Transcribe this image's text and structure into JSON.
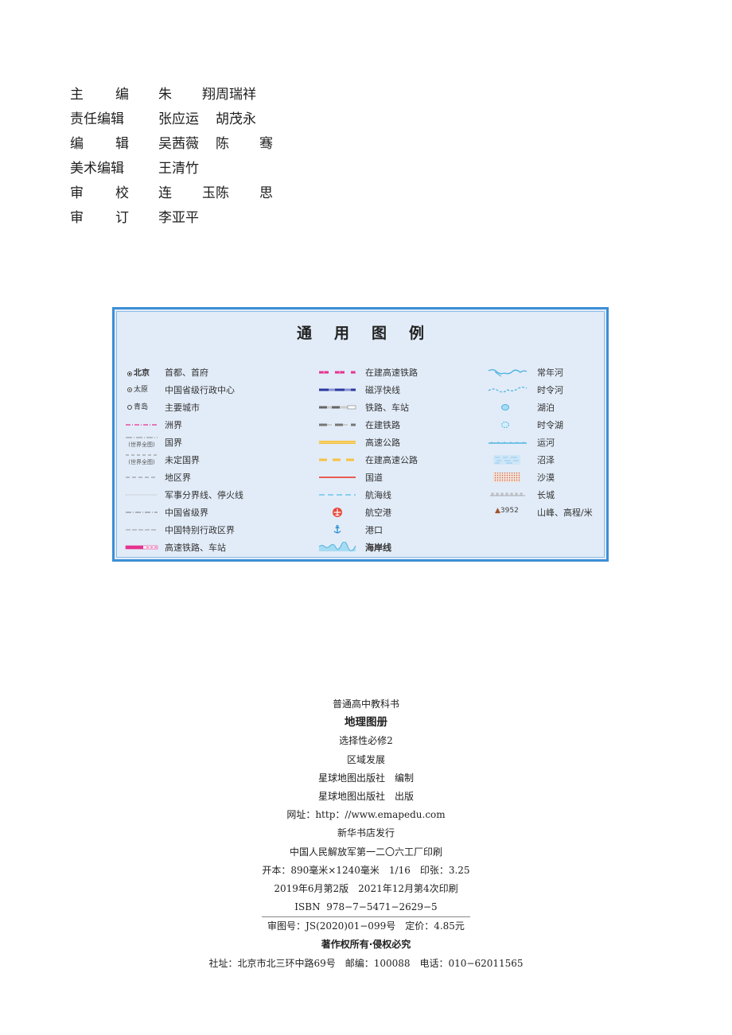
{
  "credits": [
    {
      "role": "主编",
      "names": [
        "朱翔",
        "周瑞祥"
      ]
    },
    {
      "role": "责任编辑",
      "names": [
        "张应运",
        "胡茂永"
      ]
    },
    {
      "role": "编辑",
      "names": [
        "吴茜薇",
        "陈骞"
      ]
    },
    {
      "role": "美术编辑",
      "names": [
        "王清竹"
      ]
    },
    {
      "role": "审校",
      "names": [
        "连玉",
        "陈思"
      ]
    },
    {
      "role": "审订",
      "names": [
        "李亚平"
      ]
    }
  ],
  "legend": {
    "title": "通用图例",
    "col1": [
      {
        "symbol": "capital-city",
        "city": "北京",
        "label": "首都、首府"
      },
      {
        "symbol": "provincial-capital",
        "city": "太原",
        "label": "中国省级行政中心"
      },
      {
        "symbol": "major-city",
        "city": "青岛",
        "label": "主要城市"
      },
      {
        "symbol": "continent-boundary",
        "label": "洲界"
      },
      {
        "symbol": "national-boundary",
        "note": "(世界全图)",
        "label": "国界"
      },
      {
        "symbol": "undefined-boundary",
        "note": "(世界全图)",
        "label": "未定国界"
      },
      {
        "symbol": "regional-boundary",
        "label": "地区界"
      },
      {
        "symbol": "ceasefire-line",
        "label": "军事分界线、停火线"
      },
      {
        "symbol": "provincial-boundary",
        "label": "中国省级界"
      },
      {
        "symbol": "sar-boundary",
        "label": "中国特别行政区界"
      },
      {
        "symbol": "high-speed-rail",
        "label": "高速铁路、车站"
      }
    ],
    "col2": [
      {
        "symbol": "hsr-under-construction",
        "label": "在建高速铁路"
      },
      {
        "symbol": "maglev",
        "label": "磁浮快线"
      },
      {
        "symbol": "railway-station",
        "label": "铁路、车站"
      },
      {
        "symbol": "railway-under-construction",
        "label": "在建铁路"
      },
      {
        "symbol": "expressway",
        "label": "高速公路"
      },
      {
        "symbol": "expressway-under-construction",
        "label": "在建高速公路"
      },
      {
        "symbol": "national-road",
        "label": "国道"
      },
      {
        "symbol": "sea-route",
        "label": "航海线"
      },
      {
        "symbol": "airport",
        "label": "航空港"
      },
      {
        "symbol": "port",
        "label": "港口"
      },
      {
        "symbol": "coastline",
        "label": "海岸线"
      }
    ],
    "col3": [
      {
        "symbol": "perennial-river",
        "label": "常年河"
      },
      {
        "symbol": "seasonal-river",
        "label": "时令河"
      },
      {
        "symbol": "lake",
        "label": "湖泊"
      },
      {
        "symbol": "seasonal-lake",
        "label": "时令湖"
      },
      {
        "symbol": "canal",
        "label": "运河"
      },
      {
        "symbol": "marsh",
        "label": "沼泽"
      },
      {
        "symbol": "desert",
        "label": "沙漠"
      },
      {
        "symbol": "great-wall",
        "label": "长城"
      },
      {
        "symbol": "peak",
        "elevation": "3952",
        "label": "山峰、高程/米"
      }
    ],
    "colors": {
      "border": "#3d8fd6",
      "background": "#e2ecf8",
      "hsr": "#e5338f",
      "maglev": "#2a3aa0",
      "expressway": "#f5c242",
      "national_road": "#e8483b",
      "water": "#4fb3e0"
    }
  },
  "colophon": {
    "series": "普通高中教科书",
    "title": "地理图册",
    "subtitle": "选择性必修2",
    "topic": "区域发展",
    "compiler": "星球地图出版社　编制",
    "publisher": "星球地图出版社　出版",
    "website": "网址：http：//www.emapedu.com",
    "distributor": "新华书店发行",
    "printer": "中国人民解放军第一二〇六工厂印刷",
    "format": "开本：890毫米×1240毫米　1/16　印张：3.25",
    "edition": "2019年6月第2版　2021年12月第4次印刷",
    "isbn": "ISBN  978−7−5471−2629−5",
    "review_price": "审图号：JS(2020)01−099号　定价：4.85元",
    "copyright": "著作权所有·侵权必究",
    "address": "社址：北京市北三环中路69号　邮编：100088　电话：010−62011565"
  }
}
